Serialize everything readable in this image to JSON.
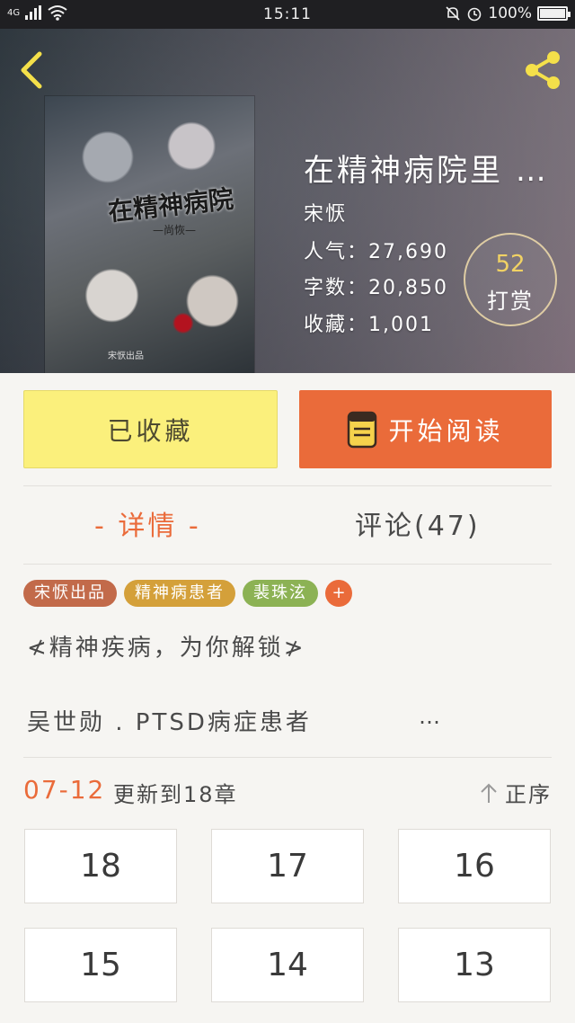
{
  "status_bar": {
    "network": "4G",
    "time": "15:11",
    "battery": "100%"
  },
  "book": {
    "title": "在精神病院里 …",
    "cover_title": "在精神病院",
    "cover_subtitle": "—尚恢—",
    "cover_footer": "宋恹出品",
    "author": "宋恹",
    "popularity": "人气：27,690",
    "word_count": "字数：20,850",
    "favorites": "收藏：1,001"
  },
  "reward": {
    "count": "52",
    "label": "打赏"
  },
  "actions": {
    "collected_label": "已收藏",
    "read_label": "开始阅读"
  },
  "tabs": {
    "detail": "- 详情 -",
    "comments": "评论(47)"
  },
  "tags": [
    "宋恹出品",
    "精神病患者",
    "裴珠泫"
  ],
  "tag_add": "+",
  "summary": {
    "line1": "≮精神疾病，为你解锁≯",
    "line2": "吴世勋 . PTSD病症患者",
    "more": "…"
  },
  "update": {
    "date": "07-12",
    "text": "更新到18章",
    "sort_label": "正序"
  },
  "chapters": [
    "18",
    "17",
    "16",
    "15",
    "14",
    "13"
  ],
  "colors": {
    "accent": "#ea6b3a",
    "collected_bg": "#fbf07c",
    "reward_num": "#f1d264"
  }
}
